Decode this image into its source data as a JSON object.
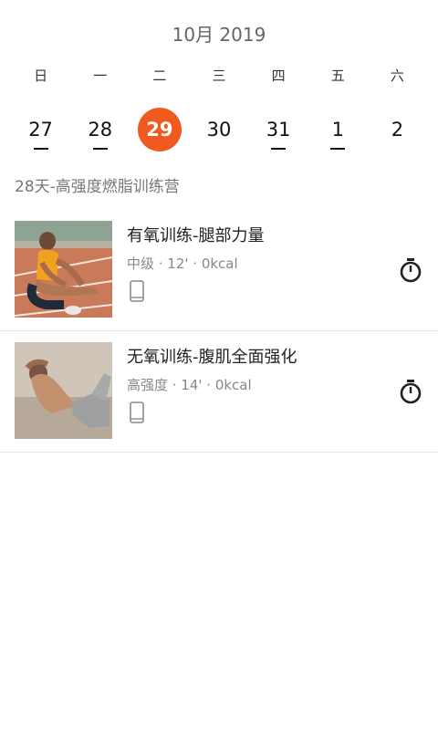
{
  "calendar": {
    "month_label": "10月 2019",
    "weekdays": [
      "日",
      "一",
      "二",
      "三",
      "四",
      "五",
      "六"
    ],
    "dates": [
      {
        "day": "27",
        "has_workout": true,
        "selected": false
      },
      {
        "day": "28",
        "has_workout": true,
        "selected": false
      },
      {
        "day": "29",
        "has_workout": false,
        "selected": true
      },
      {
        "day": "30",
        "has_workout": false,
        "selected": false
      },
      {
        "day": "31",
        "has_workout": true,
        "selected": false
      },
      {
        "day": "1",
        "has_workout": true,
        "selected": false
      },
      {
        "day": "2",
        "has_workout": false,
        "selected": false
      }
    ],
    "accent_color": "#f05a1e"
  },
  "plan": {
    "title": "28天-高强度燃脂训练营"
  },
  "workouts": [
    {
      "name": "有氧训练-腿部力量",
      "meta": "中级 · 12' · 0kcal",
      "thumbnail": "man-stretching-on-track-photo",
      "device_icon": "phone-icon",
      "action_icon": "stopwatch-icon"
    },
    {
      "name": "无氧训练-腹肌全面强化",
      "meta": "高强度 · 14' · 0kcal",
      "thumbnail": "man-doing-situps-photo",
      "device_icon": "phone-icon",
      "action_icon": "stopwatch-icon"
    }
  ]
}
